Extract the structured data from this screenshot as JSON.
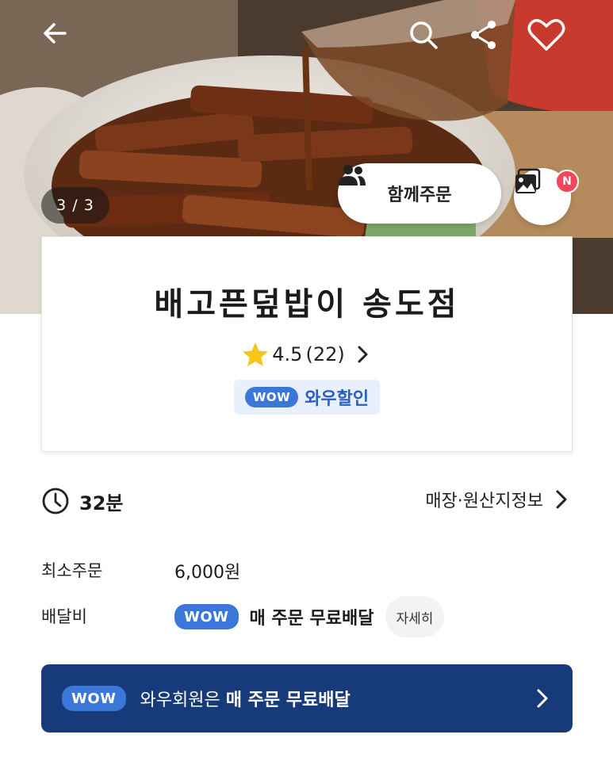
{
  "hero": {
    "photo_counter": "3 / 3",
    "together_order_label": "함께주문",
    "new_badge": "N",
    "icons": [
      "arrow-left-icon",
      "search-icon",
      "share-icon",
      "heart-icon",
      "people-icon",
      "photo-gallery-icon"
    ]
  },
  "store": {
    "name": "배고픈덮밥이 송도점",
    "rating": "4.5",
    "review_count": "(22)",
    "wow_logo": "WOW",
    "wow_discount_label": "와우할인"
  },
  "delivery": {
    "time": "32분",
    "store_info_link": "매장·원산지정보",
    "min_order_label": "최소주문",
    "min_order_value": "6,000원",
    "fee_label": "배달비",
    "fee_wow_logo": "WOW",
    "fee_value": "매 주문 무료배달",
    "detail_button": "자세히"
  },
  "banner": {
    "wow_logo": "WOW",
    "text_prefix": "와우회원은 ",
    "text_bold": "매 주문 무료배달"
  },
  "colors": {
    "wow_blue": "#3a77d9",
    "banner_navy": "#173a7a",
    "star_yellow": "#f5c518",
    "badge_red": "#f0485a"
  }
}
